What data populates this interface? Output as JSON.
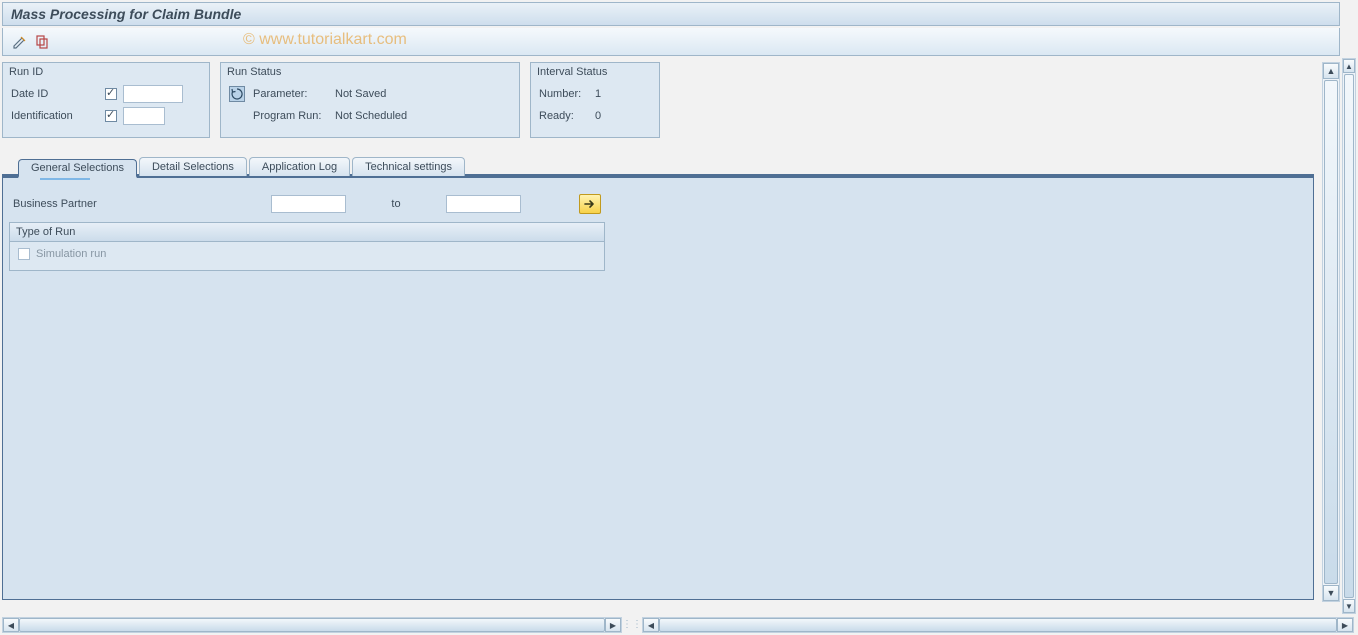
{
  "title": "Mass Processing for Claim Bundle",
  "watermark": "© www.tutorialkart.com",
  "toolbar": {
    "btn1_name": "edit-icon",
    "btn2_name": "copy-icon"
  },
  "groups": {
    "runid": {
      "legend": "Run ID",
      "date_id_label": "Date ID",
      "date_id_value": "",
      "identification_label": "Identification",
      "identification_value": ""
    },
    "runstatus": {
      "legend": "Run Status",
      "parameter_label": "Parameter:",
      "parameter_value": "Not Saved",
      "programrun_label": "Program Run:",
      "programrun_value": "Not Scheduled"
    },
    "interval": {
      "legend": "Interval Status",
      "number_label": "Number:",
      "number_value": "1",
      "ready_label": "Ready:",
      "ready_value": "0"
    }
  },
  "tabs": {
    "general": "General Selections",
    "detail": "Detail Selections",
    "applog": "Application Log",
    "tech": "Technical settings"
  },
  "general_tab": {
    "bp_label": "Business Partner",
    "bp_from": "",
    "to_label": "to",
    "bp_to": "",
    "type_of_run_legend": "Type of Run",
    "simulation_label": "Simulation run",
    "simulation_checked": false
  }
}
